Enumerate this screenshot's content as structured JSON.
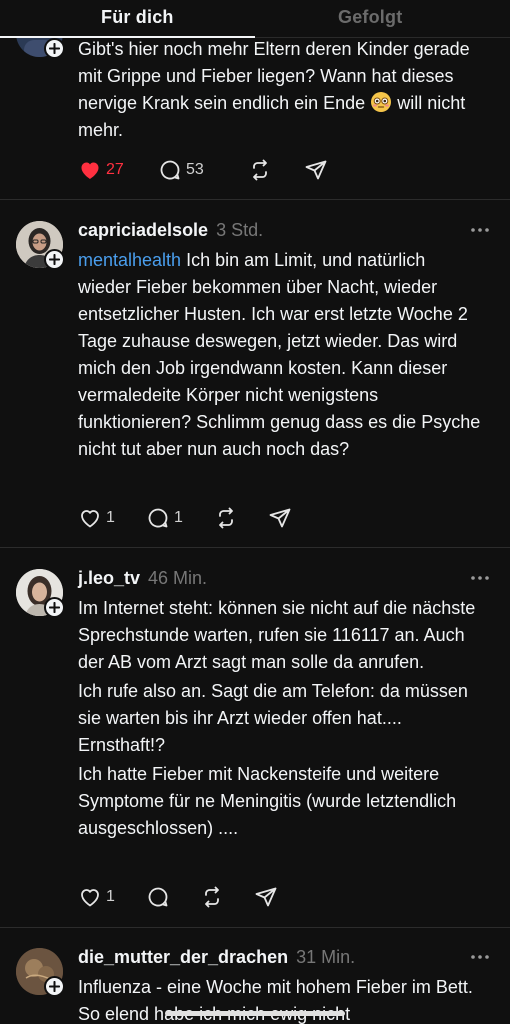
{
  "tabs": [
    {
      "label": "Für dich",
      "active": true
    },
    {
      "label": "Gefolgt",
      "active": false
    }
  ],
  "posts": [
    {
      "username": "",
      "time": "",
      "lines": [
        "Gibt's hier noch mehr Eltern deren Kinder gerade mit Grippe und Fieber liegen? Wann hat dieses nervige Krank sein endlich ein Ende",
        "will nicht mehr."
      ],
      "emoji": "flushed-face",
      "likes": "27",
      "liked": true,
      "replies": "53"
    },
    {
      "username": "capriciadelsole",
      "time": "3 Std.",
      "tag": "mentalhealth",
      "paragraphs": [
        "Ich bin am Limit, und natürlich wieder Fieber bekommen über Nacht, wieder entsetzlicher Husten. Ich war erst letzte Woche 2 Tage zuhause deswegen, jetzt wieder. Das wird mich den Job irgendwann kosten. Kann dieser vermaledeite Körper nicht wenigstens funktionieren? Schlimm genug dass es die Psyche nicht tut aber nun auch noch das?"
      ],
      "likes": "1",
      "replies": "1"
    },
    {
      "username": "j.leo_tv",
      "time": "46 Min.",
      "paragraphs": [
        "Im Internet steht: können sie nicht auf die nächste Sprechstunde warten, rufen sie 116117 an. Auch der AB vom Arzt sagt man solle da anrufen.",
        "Ich rufe also an. Sagt die am Telefon: da müssen sie warten bis ihr Arzt wieder offen hat.... Ernsthaft!?",
        "Ich hatte Fieber mit Nackensteife und weitere Symptome für ne Meningitis (wurde letztendlich ausgeschlossen) ...."
      ],
      "likes": "1",
      "replies": ""
    },
    {
      "username": "die_mutter_der_drachen",
      "time": "31 Min.",
      "paragraphs": [
        "Influenza - eine Woche mit hohem Fieber im Bett. So elend habe ich mich ewig nicht"
      ]
    }
  ],
  "icons": {
    "heart": "heart-icon",
    "reply": "reply-icon",
    "repost": "repost-icon",
    "share": "share-icon",
    "more": "more-icon",
    "follow": "plus-icon"
  },
  "colors": {
    "background": "#101010",
    "like": "#ff3040",
    "tag": "#4a9eed",
    "muted": "#777777"
  }
}
